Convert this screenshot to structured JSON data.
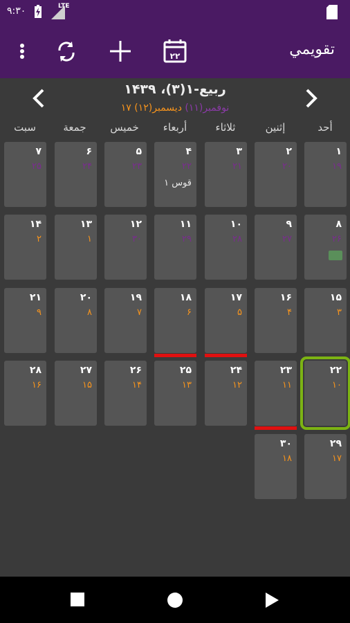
{
  "status": {
    "time": "٩:٣٠",
    "lte": "LTE"
  },
  "toolbar": {
    "title": "تقويمي",
    "today_number": "۲۲"
  },
  "month": {
    "title": "ربیع-۱(۳)، ۱۴۳۹",
    "sub_other": "نوفمبر(۱۱) ",
    "sub_greg": "دیسمبر(۱۲) ۱۷"
  },
  "weekdays": [
    "سبت",
    "جمعة",
    "خميس",
    "أربعاء",
    "ثلاثاء",
    "إثنين",
    "أحد"
  ],
  "rows": [
    [
      {
        "d": "۷",
        "s": "۲۵",
        "c": "purple"
      },
      {
        "d": "۶",
        "s": "۲۴",
        "c": "purple"
      },
      {
        "d": "۵",
        "s": "۲۳",
        "c": "purple"
      },
      {
        "d": "۴",
        "s": "۲۲",
        "c": "purple",
        "ev": "قوس ۱"
      },
      {
        "d": "۳",
        "s": "۲۱",
        "c": "purple"
      },
      {
        "d": "۲",
        "s": "۲۰",
        "c": "purple"
      },
      {
        "d": "۱",
        "s": "۱۹",
        "c": "purple"
      }
    ],
    [
      {
        "d": "۱۴",
        "s": "۲",
        "c": "orange"
      },
      {
        "d": "۱۳",
        "s": "۱",
        "c": "orange"
      },
      {
        "d": "۱۲",
        "s": "۳۰",
        "c": "purple"
      },
      {
        "d": "۱۱",
        "s": "۲۹",
        "c": "purple"
      },
      {
        "d": "۱۰",
        "s": "۲۸",
        "c": "purple"
      },
      {
        "d": "۹",
        "s": "۲۷",
        "c": "purple"
      },
      {
        "d": "۸",
        "s": "۲۶",
        "c": "purple",
        "money": true
      }
    ],
    [
      {
        "d": "۲۱",
        "s": "۹",
        "c": "orange"
      },
      {
        "d": "۲۰",
        "s": "۸",
        "c": "orange"
      },
      {
        "d": "۱۹",
        "s": "۷",
        "c": "orange"
      },
      {
        "d": "۱۸",
        "s": "۶",
        "c": "orange",
        "bar": true
      },
      {
        "d": "۱۷",
        "s": "۵",
        "c": "orange",
        "bar": true
      },
      {
        "d": "۱۶",
        "s": "۴",
        "c": "orange"
      },
      {
        "d": "۱۵",
        "s": "۳",
        "c": "orange"
      }
    ],
    [
      {
        "d": "۲۸",
        "s": "۱۶",
        "c": "orange"
      },
      {
        "d": "۲۷",
        "s": "۱۵",
        "c": "orange"
      },
      {
        "d": "۲۶",
        "s": "۱۴",
        "c": "orange"
      },
      {
        "d": "۲۵",
        "s": "۱۳",
        "c": "orange"
      },
      {
        "d": "۲۴",
        "s": "۱۲",
        "c": "orange"
      },
      {
        "d": "۲۳",
        "s": "۱۱",
        "c": "orange",
        "bar": true
      },
      {
        "d": "۲۲",
        "s": "۱۰",
        "c": "orange",
        "today": true
      }
    ],
    [
      null,
      null,
      null,
      null,
      null,
      {
        "d": "۳۰",
        "s": "۱۸",
        "c": "orange"
      },
      {
        "d": "۲۹",
        "s": "۱۷",
        "c": "orange"
      }
    ]
  ],
  "colors": {
    "accent": "#4a1a63",
    "today": "#7cb313",
    "gregorian": "#f7941d",
    "other": "#7a2c8f",
    "event_bar": "#e01010"
  },
  "icons": [
    "overflow-menu-icon",
    "sync-icon",
    "add-icon",
    "calendar-today-icon",
    "chevron-left-icon",
    "chevron-right-icon"
  ]
}
